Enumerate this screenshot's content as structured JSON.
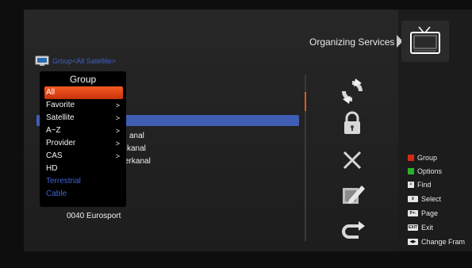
{
  "title": "Organizing Services",
  "group_header": "Group<All Satellite>",
  "popup": {
    "title": "Group",
    "items": [
      {
        "label": "All",
        "arrow": "",
        "state": "selected"
      },
      {
        "label": "Favorite",
        "arrow": ">",
        "state": "normal"
      },
      {
        "label": "Satellite",
        "arrow": ">",
        "state": "normal"
      },
      {
        "label": "A~Z",
        "arrow": ">",
        "state": "normal"
      },
      {
        "label": "Provider",
        "arrow": ">",
        "state": "normal"
      },
      {
        "label": "CAS",
        "arrow": ">",
        "state": "normal"
      },
      {
        "label": "HD",
        "arrow": "",
        "state": "normal"
      },
      {
        "label": "Terrestrial",
        "arrow": "",
        "state": "disabled"
      },
      {
        "label": "Cable",
        "arrow": "",
        "state": "disabled"
      }
    ]
  },
  "channels": {
    "row1": "anal",
    "row2": "kanal",
    "row3": "erkanal"
  },
  "bottom_item": "0040   Eurosport",
  "action_icons": [
    "move-icon",
    "lock-icon",
    "delete-icon",
    "rename-icon",
    "skip-icon"
  ],
  "legend": {
    "group": "Group",
    "options": "Options",
    "find": "Find",
    "select": "Select",
    "page": "Page",
    "exit": "Exit",
    "change_frame": "Change Fram"
  },
  "colors": {
    "red": "#d32a12",
    "green": "#28b428",
    "highlight": "#3f5db2",
    "selected": "#e6461a"
  }
}
